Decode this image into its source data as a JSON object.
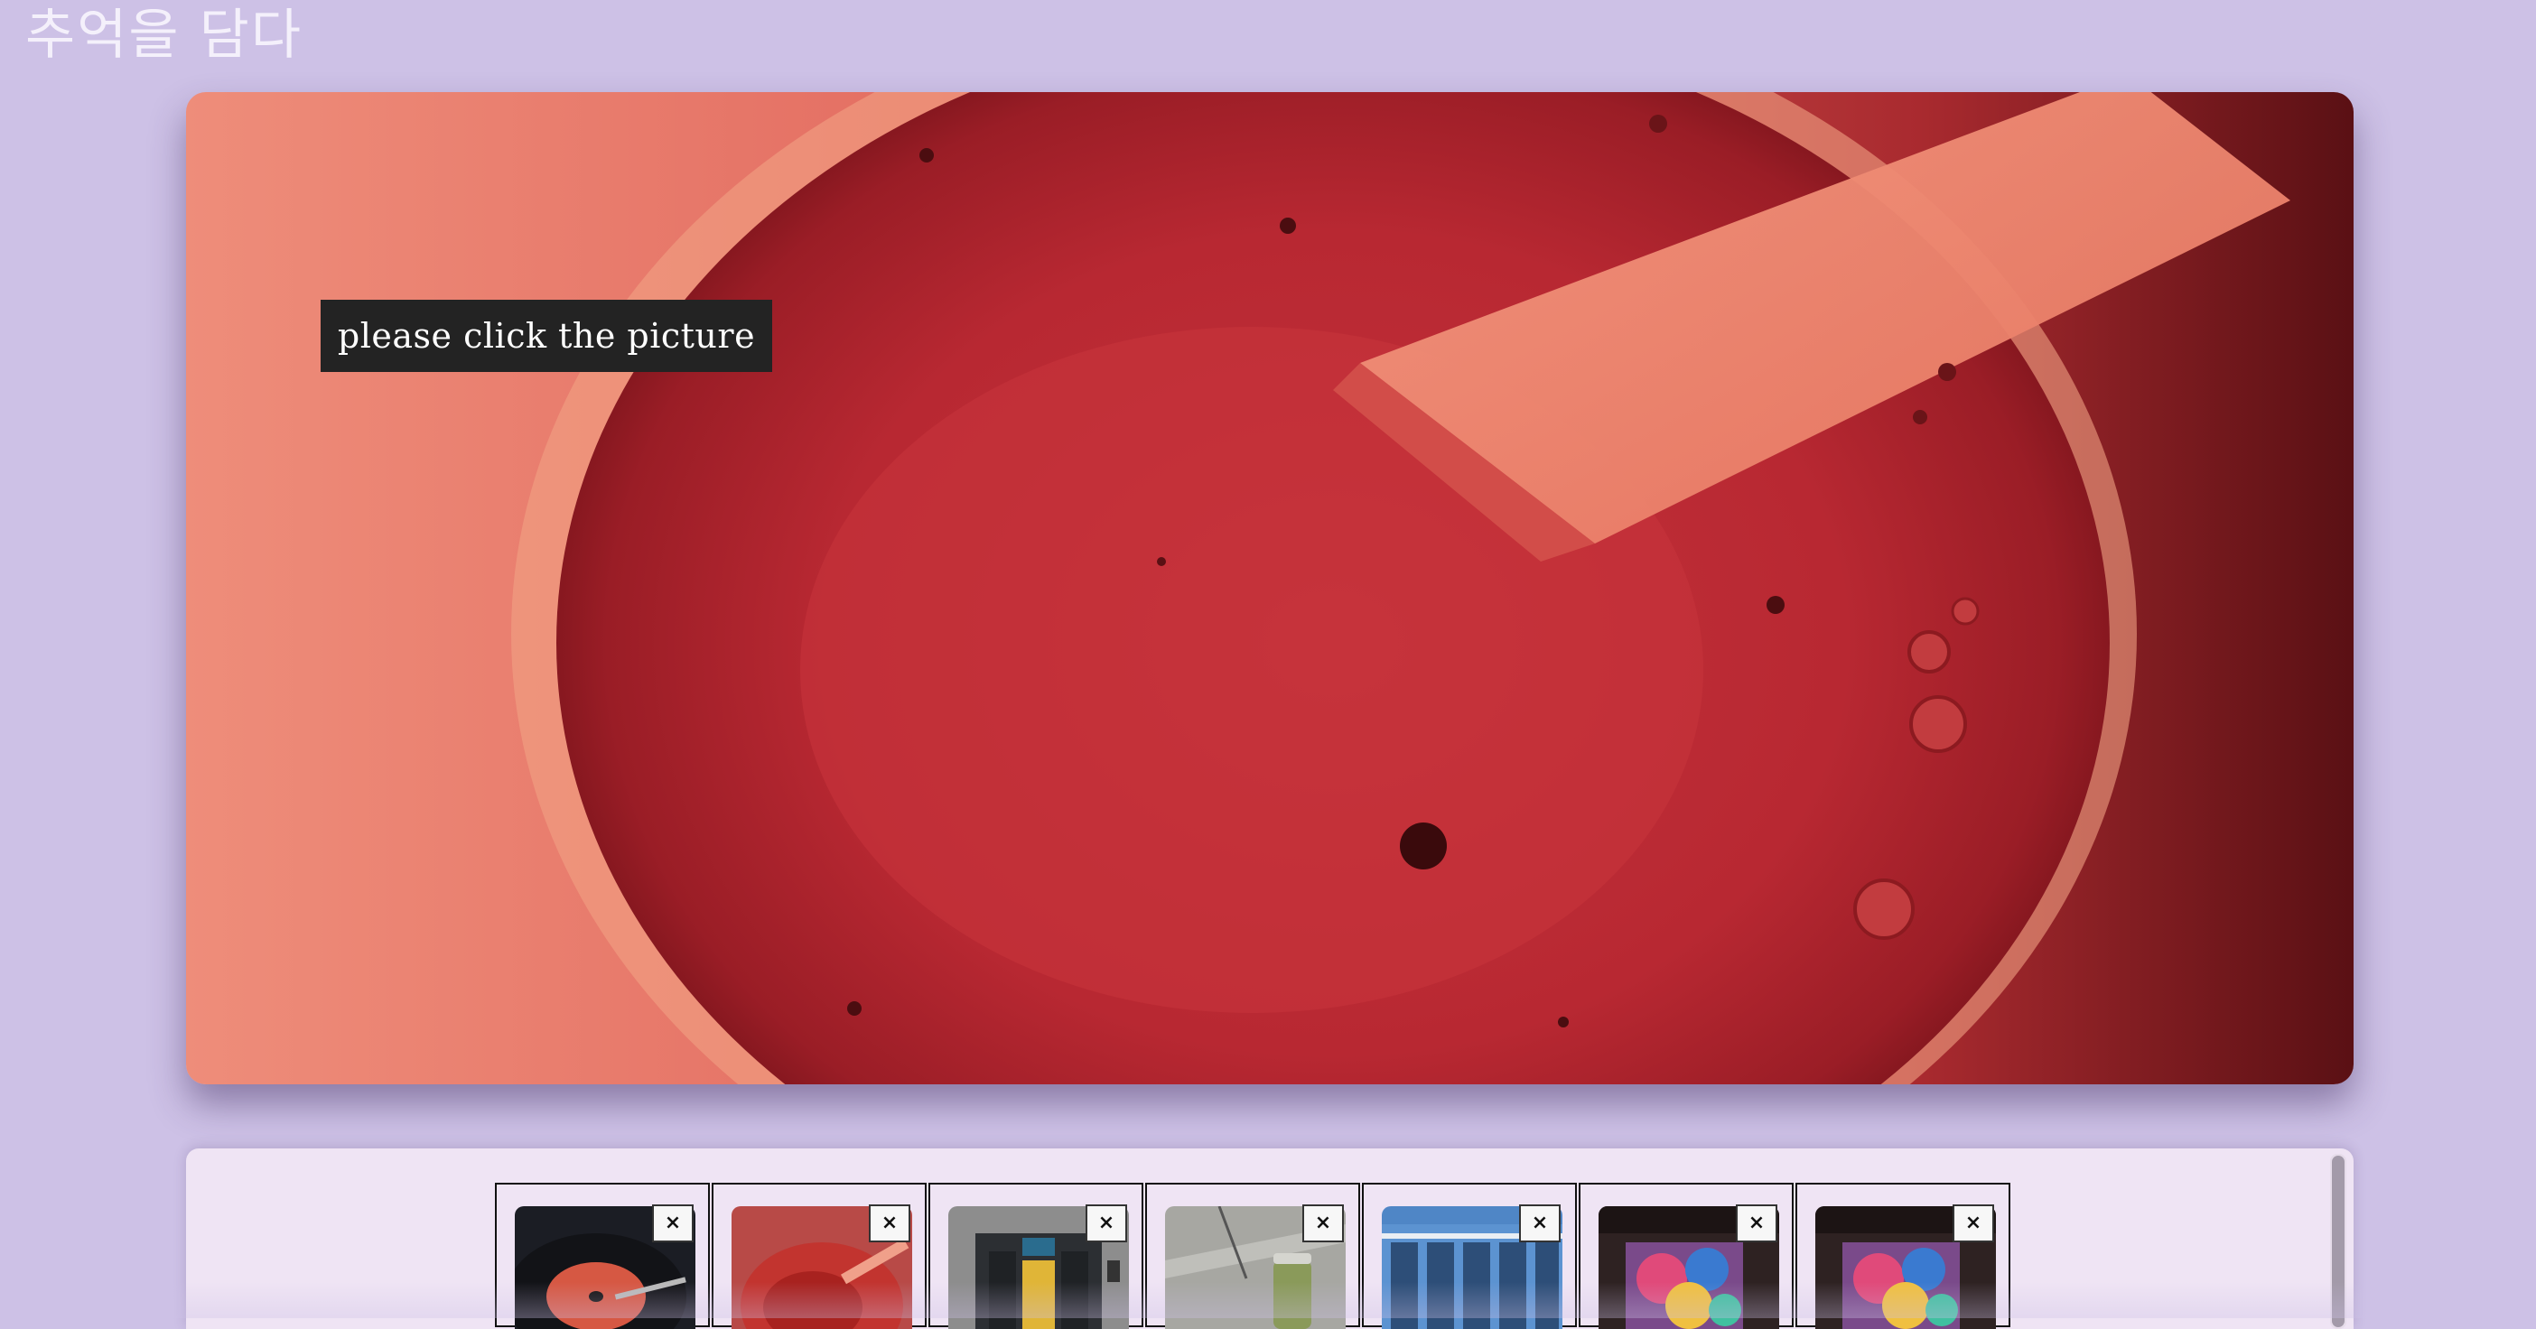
{
  "header": {
    "title": "추억을 담다"
  },
  "hero": {
    "hint": "please click the picture",
    "image_subject": "red-drink-photo"
  },
  "gallery": {
    "remove_label": "×",
    "thumbnails": [
      {
        "subject": "vinyl-record-icon",
        "remove": "×"
      },
      {
        "subject": "red-drink-icon",
        "remove": "×"
      },
      {
        "subject": "yellow-door-icon",
        "remove": "×"
      },
      {
        "subject": "green-drink-icon",
        "remove": "×"
      },
      {
        "subject": "blue-building-icon",
        "remove": "×"
      },
      {
        "subject": "colorful-artwork-icon",
        "remove": "×"
      },
      {
        "subject": "colorful-artwork-icon",
        "remove": "×"
      }
    ]
  },
  "colors": {
    "background": "#cdc1e6",
    "tray": "#efe4f4",
    "hint_bg": "#232323",
    "title": "#f4f0fb"
  }
}
